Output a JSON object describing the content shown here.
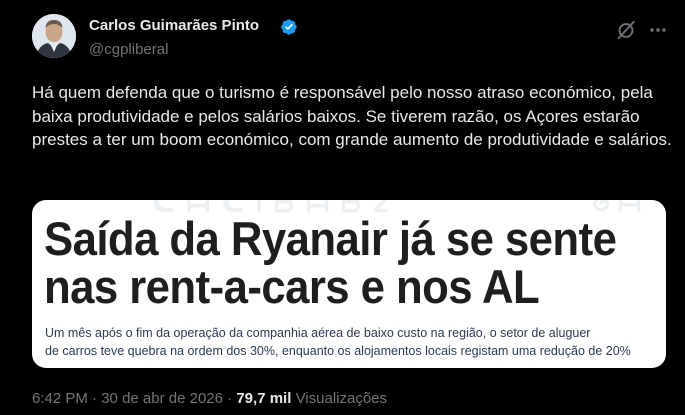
{
  "author": {
    "name": "Carlos Guimarães Pinto",
    "handle": "@cgpliberal"
  },
  "tweet": {
    "text": "Há quem defenda que o turismo é responsável pelo nosso atraso económico, pela baixa produtividade e pelos salários baixos. Se tiverem razão, os Açores estarão prestes a ter um boom económico, com grande aumento de produtividade e salários."
  },
  "media": {
    "headline_line1": "Saída da Ryanair já se sente",
    "headline_line2": "nas rent-a-cars e nos AL",
    "subtext_line1": "Um mês após o fim da operação da companhia aérea de baixo custo na região, o setor de aluguer",
    "subtext_line2": "de carros teve quebra na ordem dos 30%, enquanto os alojamentos locais registam uma redução de 20%"
  },
  "meta": {
    "time": "6:42 PM",
    "separator": "·",
    "date": "30 de abr de 2026",
    "views_count": "79,7 mil",
    "views_label": "Visualizações"
  },
  "icons": {
    "verified": "verified-badge-icon",
    "grok": "grok-icon",
    "more": "more-dots-icon"
  },
  "colors": {
    "background": "#000000",
    "text_primary": "#e7e9ea",
    "text_secondary": "#71767b",
    "verified_blue": "#1d9bf0"
  }
}
